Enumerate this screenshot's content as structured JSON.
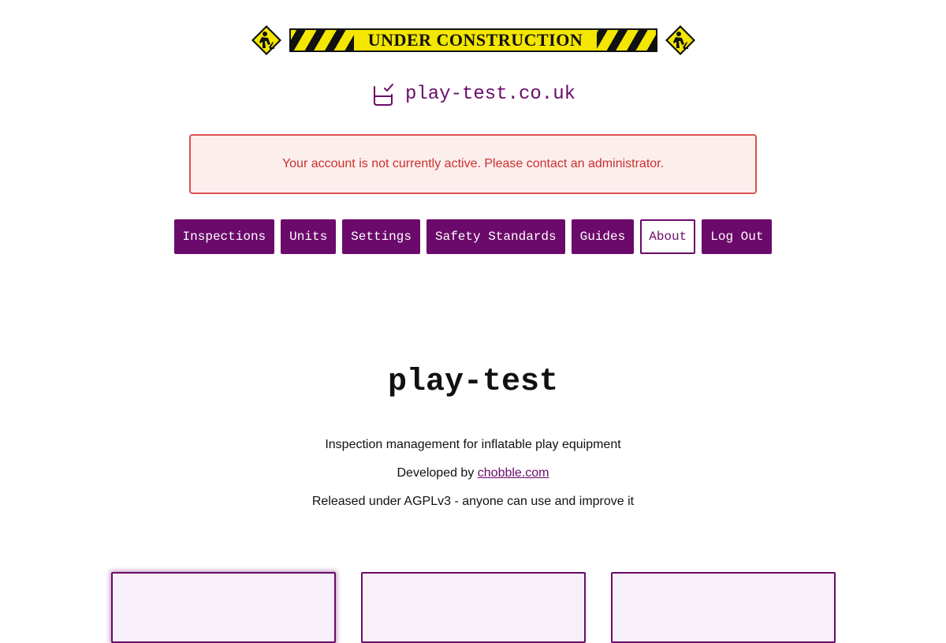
{
  "banner": {
    "text": "UNDER CONSTRUCTION",
    "left_icon": "construction-worker-sign-icon",
    "right_icon": "construction-worker-sign-icon"
  },
  "brand": {
    "icon": "checkbox-tray-icon",
    "name": "play-test.co.uk"
  },
  "alert": {
    "message": "Your account is not currently active. Please contact an administrator."
  },
  "nav": {
    "items": [
      {
        "label": "Inspections"
      },
      {
        "label": "Units"
      },
      {
        "label": "Settings"
      },
      {
        "label": "Safety Standards"
      },
      {
        "label": "Guides"
      },
      {
        "label": "About",
        "active": true
      },
      {
        "label": "Log Out"
      }
    ]
  },
  "hero": {
    "title": "play-test",
    "tagline": "Inspection management for inflatable play equipment",
    "developed_prefix": "Developed by",
    "developer_link": "chobble.com",
    "license": "Released under AGPLv3 - anyone can use and improve it"
  },
  "colors": {
    "brand": "#6b0a6a",
    "alert_border": "#d9534f",
    "alert_text": "#c9302c",
    "alert_bg": "#fdeeee",
    "card_bg": "#f7f0fb",
    "tape_yellow": "#f3e600"
  }
}
